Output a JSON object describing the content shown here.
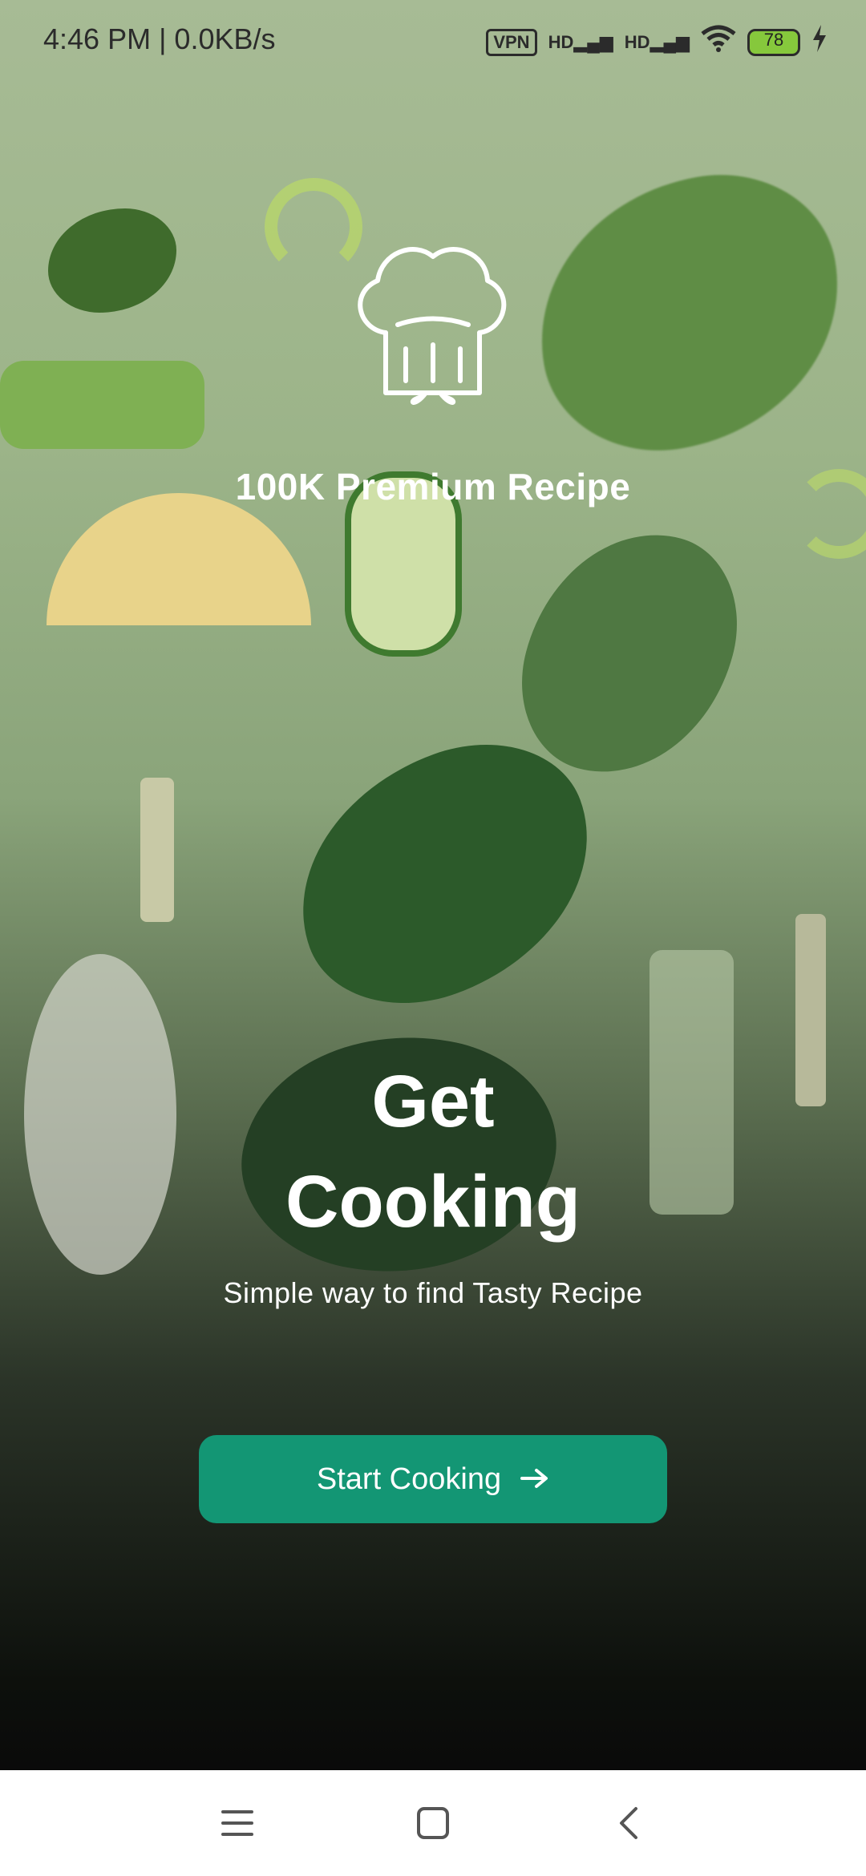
{
  "status_bar": {
    "time": "4:46 PM | 0.0KB/s",
    "vpn": "VPN",
    "signal1": "HD",
    "signal2": "HD",
    "battery": "78"
  },
  "hero": {
    "badge_text": "100K Premium Recipe",
    "title_line1": "Get",
    "title_line2": "Cooking",
    "subtitle": "Simple way to find Tasty Recipe"
  },
  "cta": {
    "label": "Start Cooking",
    "color": "#139674"
  },
  "nav": {
    "menu_icon": "menu-icon",
    "home_icon": "home-square-icon",
    "back_icon": "back-chevron-icon"
  }
}
